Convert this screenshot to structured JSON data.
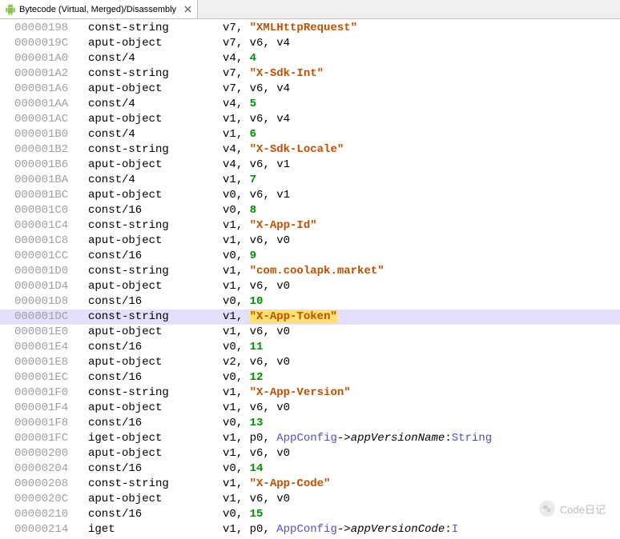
{
  "tab": {
    "title": "Bytecode (Virtual, Merged)/Disassembly",
    "icon": "android-icon"
  },
  "highlightAddress": "000001DC",
  "highlightToken": "\"X-App-Token\"",
  "lines": [
    {
      "addr": "00000198",
      "instr": "const-string",
      "ops": [
        {
          "t": "reg",
          "v": "v7"
        },
        {
          "t": "plain",
          "v": ", "
        },
        {
          "t": "str",
          "v": "\"XMLHttpRequest\""
        }
      ]
    },
    {
      "addr": "0000019C",
      "instr": "aput-object",
      "ops": [
        {
          "t": "reg",
          "v": "v7"
        },
        {
          "t": "plain",
          "v": ", "
        },
        {
          "t": "reg",
          "v": "v6"
        },
        {
          "t": "plain",
          "v": ", "
        },
        {
          "t": "reg",
          "v": "v4"
        }
      ]
    },
    {
      "addr": "000001A0",
      "instr": "const/4",
      "ops": [
        {
          "t": "reg",
          "v": "v4"
        },
        {
          "t": "plain",
          "v": ", "
        },
        {
          "t": "num",
          "v": "4"
        }
      ]
    },
    {
      "addr": "000001A2",
      "instr": "const-string",
      "ops": [
        {
          "t": "reg",
          "v": "v7"
        },
        {
          "t": "plain",
          "v": ", "
        },
        {
          "t": "str",
          "v": "\"X-Sdk-Int\""
        }
      ]
    },
    {
      "addr": "000001A6",
      "instr": "aput-object",
      "ops": [
        {
          "t": "reg",
          "v": "v7"
        },
        {
          "t": "plain",
          "v": ", "
        },
        {
          "t": "reg",
          "v": "v6"
        },
        {
          "t": "plain",
          "v": ", "
        },
        {
          "t": "reg",
          "v": "v4"
        }
      ]
    },
    {
      "addr": "000001AA",
      "instr": "const/4",
      "ops": [
        {
          "t": "reg",
          "v": "v4"
        },
        {
          "t": "plain",
          "v": ", "
        },
        {
          "t": "num",
          "v": "5"
        }
      ]
    },
    {
      "addr": "000001AC",
      "instr": "aput-object",
      "ops": [
        {
          "t": "reg",
          "v": "v1"
        },
        {
          "t": "plain",
          "v": ", "
        },
        {
          "t": "reg",
          "v": "v6"
        },
        {
          "t": "plain",
          "v": ", "
        },
        {
          "t": "reg",
          "v": "v4"
        }
      ]
    },
    {
      "addr": "000001B0",
      "instr": "const/4",
      "ops": [
        {
          "t": "reg",
          "v": "v1"
        },
        {
          "t": "plain",
          "v": ", "
        },
        {
          "t": "num",
          "v": "6"
        }
      ]
    },
    {
      "addr": "000001B2",
      "instr": "const-string",
      "ops": [
        {
          "t": "reg",
          "v": "v4"
        },
        {
          "t": "plain",
          "v": ", "
        },
        {
          "t": "str",
          "v": "\"X-Sdk-Locale\""
        }
      ]
    },
    {
      "addr": "000001B6",
      "instr": "aput-object",
      "ops": [
        {
          "t": "reg",
          "v": "v4"
        },
        {
          "t": "plain",
          "v": ", "
        },
        {
          "t": "reg",
          "v": "v6"
        },
        {
          "t": "plain",
          "v": ", "
        },
        {
          "t": "reg",
          "v": "v1"
        }
      ]
    },
    {
      "addr": "000001BA",
      "instr": "const/4",
      "ops": [
        {
          "t": "reg",
          "v": "v1"
        },
        {
          "t": "plain",
          "v": ", "
        },
        {
          "t": "num",
          "v": "7"
        }
      ]
    },
    {
      "addr": "000001BC",
      "instr": "aput-object",
      "ops": [
        {
          "t": "reg",
          "v": "v0"
        },
        {
          "t": "plain",
          "v": ", "
        },
        {
          "t": "reg",
          "v": "v6"
        },
        {
          "t": "plain",
          "v": ", "
        },
        {
          "t": "reg",
          "v": "v1"
        }
      ]
    },
    {
      "addr": "000001C0",
      "instr": "const/16",
      "ops": [
        {
          "t": "reg",
          "v": "v0"
        },
        {
          "t": "plain",
          "v": ", "
        },
        {
          "t": "num",
          "v": "8"
        }
      ]
    },
    {
      "addr": "000001C4",
      "instr": "const-string",
      "ops": [
        {
          "t": "reg",
          "v": "v1"
        },
        {
          "t": "plain",
          "v": ", "
        },
        {
          "t": "str",
          "v": "\"X-App-Id\""
        }
      ]
    },
    {
      "addr": "000001C8",
      "instr": "aput-object",
      "ops": [
        {
          "t": "reg",
          "v": "v1"
        },
        {
          "t": "plain",
          "v": ", "
        },
        {
          "t": "reg",
          "v": "v6"
        },
        {
          "t": "plain",
          "v": ", "
        },
        {
          "t": "reg",
          "v": "v0"
        }
      ]
    },
    {
      "addr": "000001CC",
      "instr": "const/16",
      "ops": [
        {
          "t": "reg",
          "v": "v0"
        },
        {
          "t": "plain",
          "v": ", "
        },
        {
          "t": "num",
          "v": "9"
        }
      ]
    },
    {
      "addr": "000001D0",
      "instr": "const-string",
      "ops": [
        {
          "t": "reg",
          "v": "v1"
        },
        {
          "t": "plain",
          "v": ", "
        },
        {
          "t": "str",
          "v": "\"com.coolapk.market\""
        }
      ]
    },
    {
      "addr": "000001D4",
      "instr": "aput-object",
      "ops": [
        {
          "t": "reg",
          "v": "v1"
        },
        {
          "t": "plain",
          "v": ", "
        },
        {
          "t": "reg",
          "v": "v6"
        },
        {
          "t": "plain",
          "v": ", "
        },
        {
          "t": "reg",
          "v": "v0"
        }
      ]
    },
    {
      "addr": "000001D8",
      "instr": "const/16",
      "ops": [
        {
          "t": "reg",
          "v": "v0"
        },
        {
          "t": "plain",
          "v": ", "
        },
        {
          "t": "num",
          "v": "10"
        }
      ]
    },
    {
      "addr": "000001DC",
      "instr": "const-string",
      "hl": true,
      "ops": [
        {
          "t": "reg",
          "v": "v1"
        },
        {
          "t": "plain",
          "v": ", "
        },
        {
          "t": "str-hl",
          "v": "\"X-App-Token\""
        }
      ]
    },
    {
      "addr": "000001E0",
      "instr": "aput-object",
      "ops": [
        {
          "t": "reg",
          "v": "v1"
        },
        {
          "t": "plain",
          "v": ", "
        },
        {
          "t": "reg",
          "v": "v6"
        },
        {
          "t": "plain",
          "v": ", "
        },
        {
          "t": "reg",
          "v": "v0"
        }
      ]
    },
    {
      "addr": "000001E4",
      "instr": "const/16",
      "ops": [
        {
          "t": "reg",
          "v": "v0"
        },
        {
          "t": "plain",
          "v": ", "
        },
        {
          "t": "num",
          "v": "11"
        }
      ]
    },
    {
      "addr": "000001E8",
      "instr": "aput-object",
      "ops": [
        {
          "t": "reg",
          "v": "v2"
        },
        {
          "t": "plain",
          "v": ", "
        },
        {
          "t": "reg",
          "v": "v6"
        },
        {
          "t": "plain",
          "v": ", "
        },
        {
          "t": "reg",
          "v": "v0"
        }
      ]
    },
    {
      "addr": "000001EC",
      "instr": "const/16",
      "ops": [
        {
          "t": "reg",
          "v": "v0"
        },
        {
          "t": "plain",
          "v": ", "
        },
        {
          "t": "num",
          "v": "12"
        }
      ]
    },
    {
      "addr": "000001F0",
      "instr": "const-string",
      "ops": [
        {
          "t": "reg",
          "v": "v1"
        },
        {
          "t": "plain",
          "v": ", "
        },
        {
          "t": "str",
          "v": "\"X-App-Version\""
        }
      ]
    },
    {
      "addr": "000001F4",
      "instr": "aput-object",
      "ops": [
        {
          "t": "reg",
          "v": "v1"
        },
        {
          "t": "plain",
          "v": ", "
        },
        {
          "t": "reg",
          "v": "v6"
        },
        {
          "t": "plain",
          "v": ", "
        },
        {
          "t": "reg",
          "v": "v0"
        }
      ]
    },
    {
      "addr": "000001F8",
      "instr": "const/16",
      "ops": [
        {
          "t": "reg",
          "v": "v0"
        },
        {
          "t": "plain",
          "v": ", "
        },
        {
          "t": "num",
          "v": "13"
        }
      ]
    },
    {
      "addr": "000001FC",
      "instr": "iget-object",
      "ops": [
        {
          "t": "reg",
          "v": "v1"
        },
        {
          "t": "plain",
          "v": ", "
        },
        {
          "t": "reg",
          "v": "p0"
        },
        {
          "t": "plain",
          "v": ", "
        },
        {
          "t": "type",
          "v": "AppConfig"
        },
        {
          "t": "plain",
          "v": "->"
        },
        {
          "t": "meth",
          "v": "appVersionName"
        },
        {
          "t": "plain",
          "v": ":"
        },
        {
          "t": "type",
          "v": "String"
        }
      ]
    },
    {
      "addr": "00000200",
      "instr": "aput-object",
      "ops": [
        {
          "t": "reg",
          "v": "v1"
        },
        {
          "t": "plain",
          "v": ", "
        },
        {
          "t": "reg",
          "v": "v6"
        },
        {
          "t": "plain",
          "v": ", "
        },
        {
          "t": "reg",
          "v": "v0"
        }
      ]
    },
    {
      "addr": "00000204",
      "instr": "const/16",
      "ops": [
        {
          "t": "reg",
          "v": "v0"
        },
        {
          "t": "plain",
          "v": ", "
        },
        {
          "t": "num",
          "v": "14"
        }
      ]
    },
    {
      "addr": "00000208",
      "instr": "const-string",
      "ops": [
        {
          "t": "reg",
          "v": "v1"
        },
        {
          "t": "plain",
          "v": ", "
        },
        {
          "t": "str",
          "v": "\"X-App-Code\""
        }
      ]
    },
    {
      "addr": "0000020C",
      "instr": "aput-object",
      "ops": [
        {
          "t": "reg",
          "v": "v1"
        },
        {
          "t": "plain",
          "v": ", "
        },
        {
          "t": "reg",
          "v": "v6"
        },
        {
          "t": "plain",
          "v": ", "
        },
        {
          "t": "reg",
          "v": "v0"
        }
      ]
    },
    {
      "addr": "00000210",
      "instr": "const/16",
      "ops": [
        {
          "t": "reg",
          "v": "v0"
        },
        {
          "t": "plain",
          "v": ", "
        },
        {
          "t": "num",
          "v": "15"
        }
      ]
    },
    {
      "addr": "00000214",
      "instr": "iget",
      "ops": [
        {
          "t": "reg",
          "v": "v1"
        },
        {
          "t": "plain",
          "v": ", "
        },
        {
          "t": "reg",
          "v": "p0"
        },
        {
          "t": "plain",
          "v": ", "
        },
        {
          "t": "type",
          "v": "AppConfig"
        },
        {
          "t": "plain",
          "v": "->"
        },
        {
          "t": "meth",
          "v": "appVersionCode"
        },
        {
          "t": "plain",
          "v": ":"
        },
        {
          "t": "type",
          "v": "I"
        }
      ]
    }
  ],
  "watermark": "Code日记"
}
